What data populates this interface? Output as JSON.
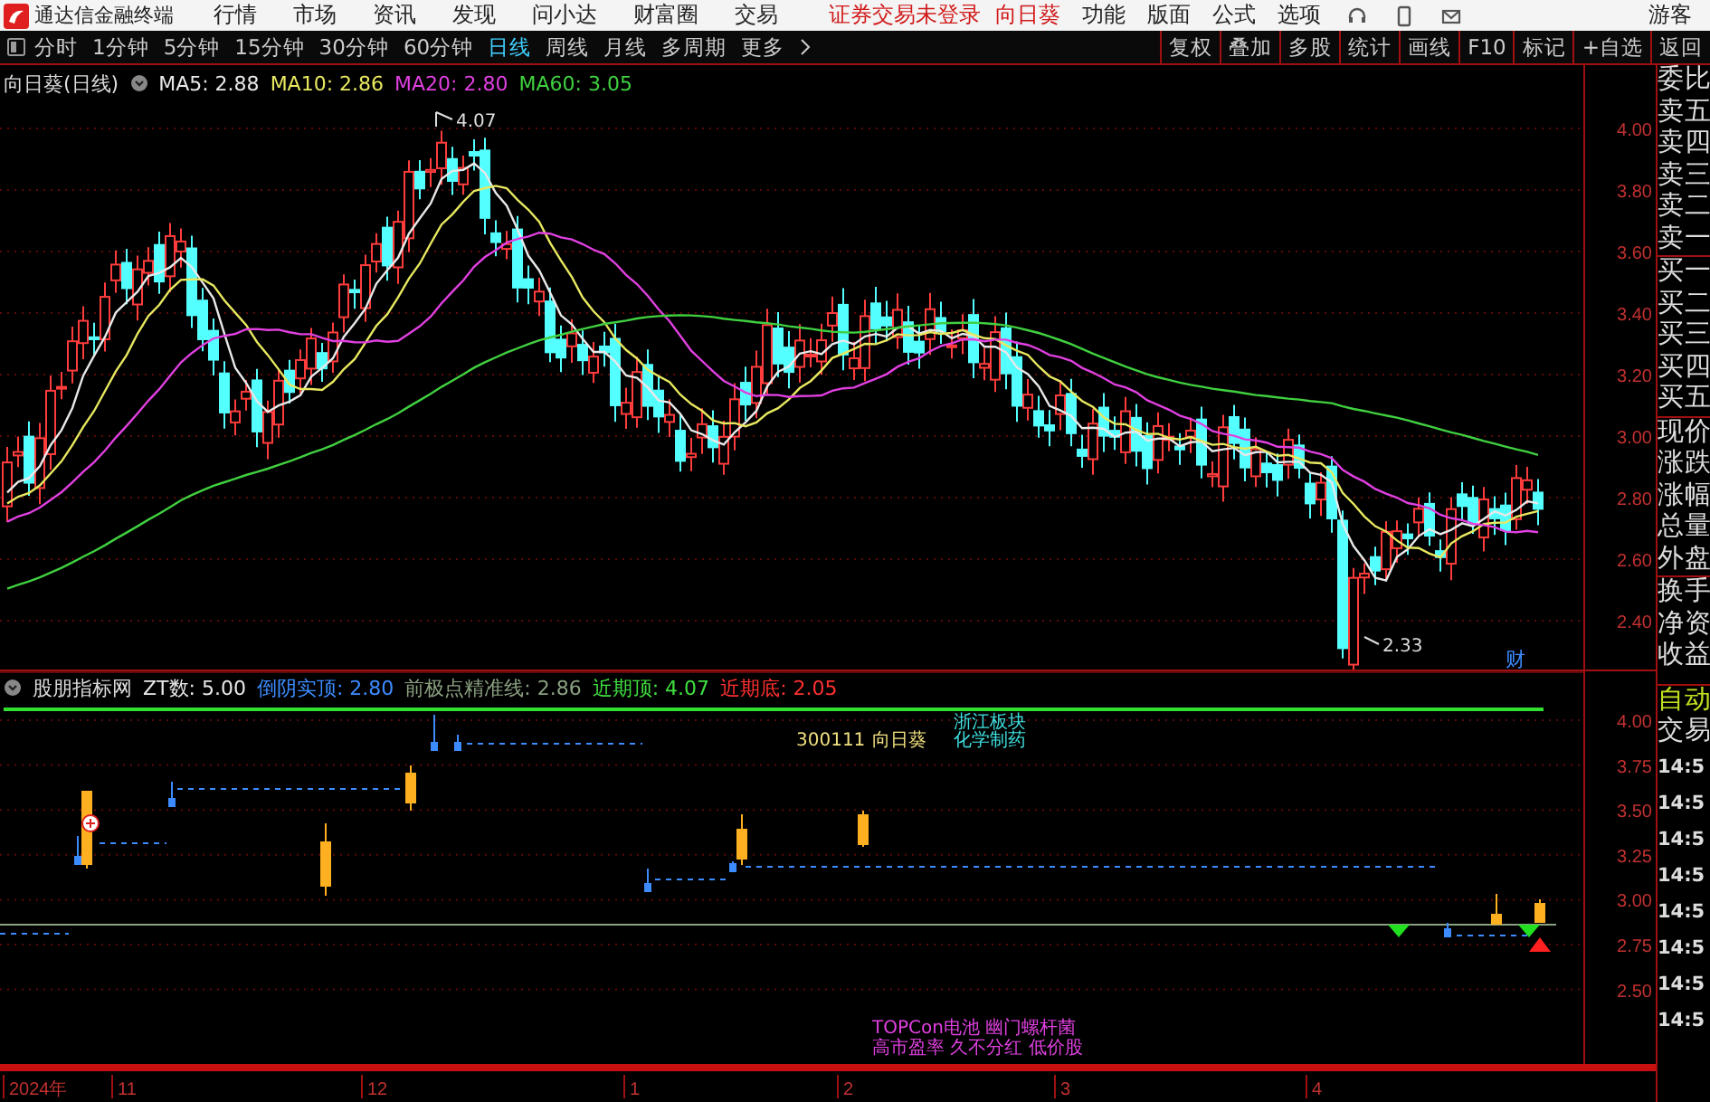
{
  "menu_bar": {
    "app_title": "通达信金融终端",
    "menus": [
      "行情",
      "市场",
      "资讯",
      "发现",
      "问小达",
      "财富圈",
      "交易"
    ],
    "login_status": "证券交易未登录",
    "stock_name": "向日葵",
    "tools": [
      "功能",
      "版面",
      "公式",
      "选项"
    ],
    "user": "游客"
  },
  "period_bar": {
    "periods": [
      {
        "label": "分时",
        "selected": false
      },
      {
        "label": "1分钟",
        "selected": false
      },
      {
        "label": "5分钟",
        "selected": false
      },
      {
        "label": "15分钟",
        "selected": false
      },
      {
        "label": "30分钟",
        "selected": false
      },
      {
        "label": "60分钟",
        "selected": false
      },
      {
        "label": "日线",
        "selected": true
      },
      {
        "label": "周线",
        "selected": false
      },
      {
        "label": "月线",
        "selected": false
      },
      {
        "label": "多周期",
        "selected": false
      }
    ],
    "more": "更多",
    "actions": [
      "复权",
      "叠加",
      "多股",
      "统计",
      "画线",
      "F10",
      "标记",
      "+自选",
      "返回"
    ]
  },
  "main_chart": {
    "title": "向日葵(日线)",
    "ma": [
      {
        "label": "MA5: 2.88",
        "color": "#e8e8e8"
      },
      {
        "label": "MA10: 2.86",
        "color": "#e8e860"
      },
      {
        "label": "MA20: 2.80",
        "color": "#e040e0"
      },
      {
        "label": "MA60: 3.05",
        "color": "#40d040"
      }
    ],
    "high_label": "4.07",
    "low_label": "2.33",
    "marker": "财",
    "y_labels": [
      "4.00",
      "3.80",
      "3.60",
      "3.40",
      "3.20",
      "3.00",
      "2.80",
      "2.60",
      "2.40"
    ]
  },
  "indicator": {
    "title": "股朋指标网",
    "values": [
      {
        "label": "ZT数: 5.00",
        "color": "#e8e8e8"
      },
      {
        "label": "倒阴实顶: 2.80",
        "color": "#3c8cff"
      },
      {
        "label": "前极点精准线: 2.86",
        "color": "#8aa080"
      },
      {
        "label": "近期顶: 4.07",
        "color": "#40e040"
      },
      {
        "label": "近期底: 2.05",
        "color": "#ff3030"
      }
    ],
    "code": "300111",
    "name": "向日葵",
    "sector_lines": [
      "浙江板块",
      "化学制药"
    ],
    "concept_lines": [
      "TOPCon电池 幽门螺杆菌",
      "高市盈率 久不分红 低价股"
    ],
    "y_labels": [
      "4.00",
      "3.75",
      "3.50",
      "3.25",
      "3.00",
      "2.75",
      "2.50"
    ]
  },
  "time_axis": [
    "2024年",
    "11",
    "12",
    "1",
    "2",
    "3",
    "4"
  ],
  "quote_panel": {
    "labels": [
      "委比",
      "卖五",
      "卖四",
      "卖三",
      "卖二",
      "卖一",
      "买一",
      "买二",
      "买三",
      "买四",
      "买五",
      "现价",
      "涨跌",
      "涨幅",
      "总量",
      "外盘",
      "换手",
      "净资",
      "收益"
    ],
    "auto_label": "自动",
    "trade_label": "交易",
    "times": [
      "14:5",
      "14:5",
      "14:5",
      "14:5",
      "14:5",
      "14:5",
      "14:5",
      "14:5"
    ]
  }
}
